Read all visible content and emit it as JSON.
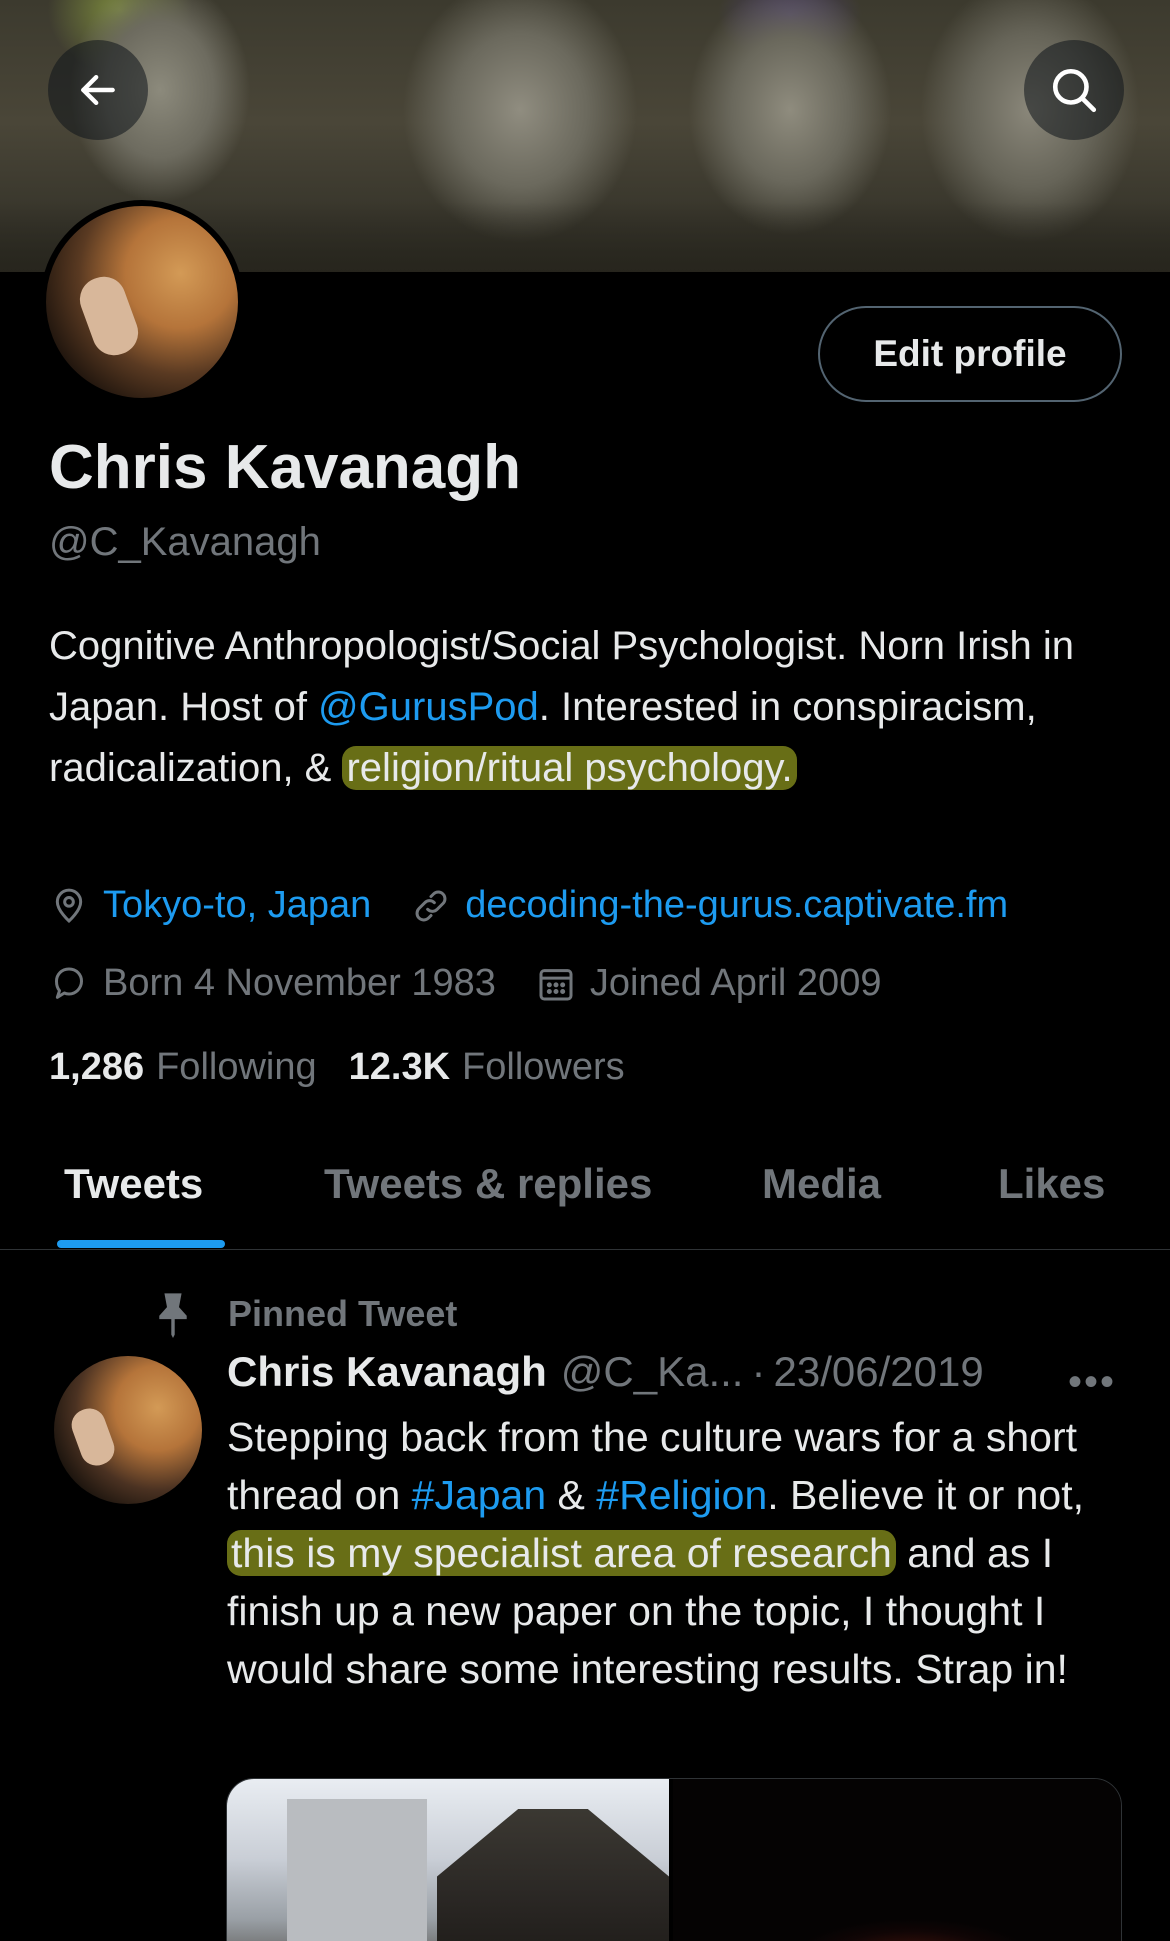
{
  "banner": {
    "alt": "Stone Buddha statues"
  },
  "header": {
    "back_label": "Back",
    "search_label": "Search"
  },
  "profile": {
    "edit_label": "Edit profile",
    "name": "Chris Kavanagh",
    "handle": "@C_Kavanagh",
    "bio": {
      "part1": "Cognitive Anthropologist/Social Psychologist. Norn Irish in Japan. Host of ",
      "mention": "@GurusPod",
      "part2": ". Interested in conspiracism, radicalization, & ",
      "highlight": "religion/ritual psychology."
    },
    "location": "Tokyo-to, Japan",
    "website": "decoding-the-gurus.captivate.fm",
    "birthday": "Born 4 November 1983",
    "joined": "Joined April 2009",
    "following_count": "1,286",
    "following_label": "Following",
    "followers_count": "12.3K",
    "followers_label": "Followers"
  },
  "tabs": [
    {
      "label": "Tweets"
    },
    {
      "label": "Tweets & replies"
    },
    {
      "label": "Media"
    },
    {
      "label": "Likes"
    }
  ],
  "tweet": {
    "pinned_label": "Pinned Tweet",
    "author": "Chris Kavanagh",
    "handle": "@C_Ka...",
    "separator": "·",
    "date": "23/06/2019",
    "more": "•••",
    "text": {
      "line_a": "Stepping back from the culture wars for a short thread on ",
      "tag1": "#Japan",
      "amp": " & ",
      "tag2": "#Religion",
      "line_b": ". Believe it or not, ",
      "highlight": "this is my specialist area of research",
      "line_c": " and as I finish up a new paper on the topic, I thought I would share some interesting results. Strap in!"
    }
  },
  "colors": {
    "accent": "#1d9bf0",
    "muted": "#71767b",
    "background": "#000000",
    "highlight": "#bec828"
  }
}
